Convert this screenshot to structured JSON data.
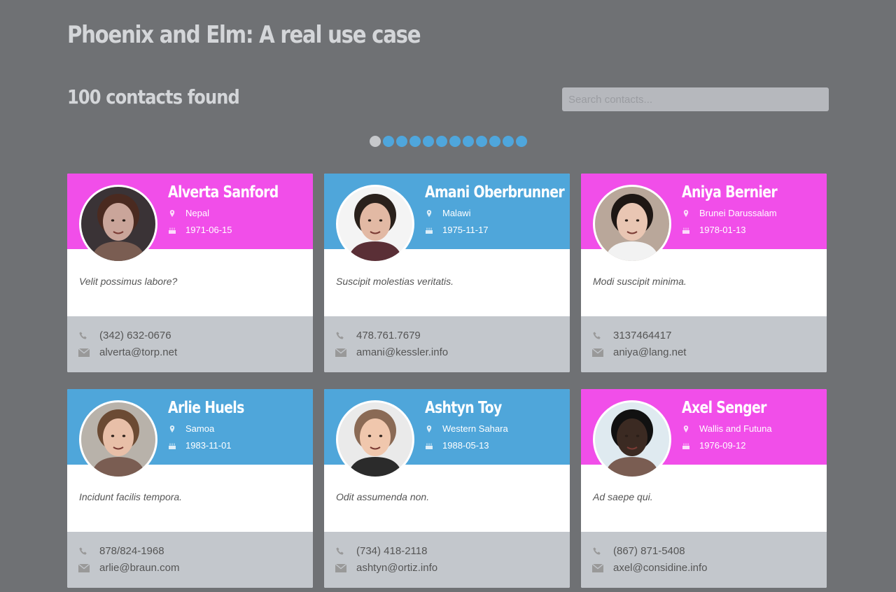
{
  "header": {
    "title": "Phoenix and Elm: A real use case",
    "count_label": "100 contacts found",
    "search_placeholder": "Search contacts..."
  },
  "pagination": {
    "pages": 12,
    "active_page": 1
  },
  "colors": {
    "pink": "#f14ee9",
    "blue": "#4fa6da",
    "background": "#6f7174",
    "footer": "#c3c7cc"
  },
  "contacts": [
    {
      "name": "Alverta Sanford",
      "country": "Nepal",
      "birth_date": "1971-06-15",
      "bio": "Velit possimus labore?",
      "phone": "(342) 632-0676",
      "email": "alverta@torp.net",
      "theme": "pink"
    },
    {
      "name": "Amani Oberbrunner",
      "country": "Malawi",
      "birth_date": "1975-11-17",
      "bio": "Suscipit molestias veritatis.",
      "phone": "478.761.7679",
      "email": "amani@kessler.info",
      "theme": "blue"
    },
    {
      "name": "Aniya Bernier",
      "country": "Brunei Darussalam",
      "birth_date": "1978-01-13",
      "bio": "Modi suscipit minima.",
      "phone": "3137464417",
      "email": "aniya@lang.net",
      "theme": "pink"
    },
    {
      "name": "Arlie Huels",
      "country": "Samoa",
      "birth_date": "1983-11-01",
      "bio": "Incidunt facilis tempora.",
      "phone": "878/824-1968",
      "email": "arlie@braun.com",
      "theme": "blue"
    },
    {
      "name": "Ashtyn Toy",
      "country": "Western Sahara",
      "birth_date": "1988-05-13",
      "bio": "Odit assumenda non.",
      "phone": "(734) 418-2118",
      "email": "ashtyn@ortiz.info",
      "theme": "blue"
    },
    {
      "name": "Axel Senger",
      "country": "Wallis and Futuna",
      "birth_date": "1976-09-12",
      "bio": "Ad saepe qui.",
      "phone": "(867) 871-5408",
      "email": "axel@considine.info",
      "theme": "pink"
    }
  ],
  "icons": {
    "location": "map-marker-icon",
    "birthday": "birthday-cake-icon",
    "phone": "phone-icon",
    "email": "envelope-icon"
  }
}
